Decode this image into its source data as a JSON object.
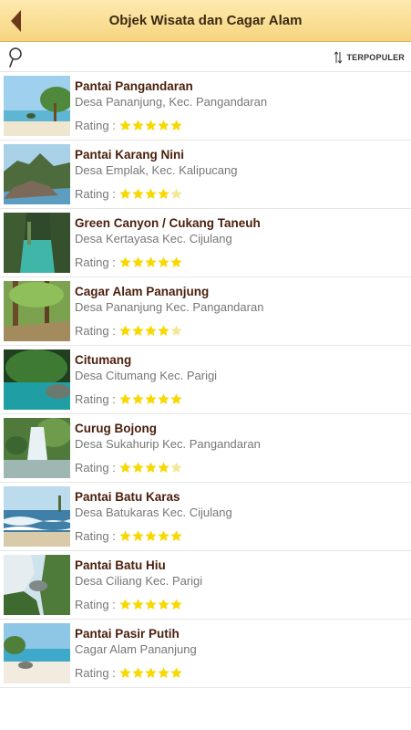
{
  "header": {
    "title": "Objek Wisata dan Cagar Alam"
  },
  "toolbar": {
    "sort_label": "TERPOPULER"
  },
  "rating_label": "Rating :",
  "colors": {
    "header_bg": "#f6d57f",
    "title_text": "#4a1f0c",
    "star_filled": "#f7d800",
    "star_empty": "#f3e89a"
  },
  "places": [
    {
      "name": "Pantai Pangandaran",
      "location": "Desa Pananjung, Kec. Pangandaran",
      "rating": 5,
      "thumb": "beach-palms"
    },
    {
      "name": "Pantai Karang Nini",
      "location": "Desa Emplak, Kec. Kalipucang",
      "rating": 4,
      "thumb": "rocky-coast"
    },
    {
      "name": "Green Canyon / Cukang Taneuh",
      "location": "Desa Kertayasa Kec. Cijulang",
      "rating": 5,
      "thumb": "canyon"
    },
    {
      "name": "Cagar Alam Pananjung",
      "location": "Desa Pananjung Kec. Pangandaran",
      "rating": 4,
      "thumb": "forest"
    },
    {
      "name": "Citumang",
      "location": "Desa Citumang Kec. Parigi",
      "rating": 5,
      "thumb": "river"
    },
    {
      "name": "Curug Bojong",
      "location": "Desa Sukahurip Kec. Pangandaran",
      "rating": 4,
      "thumb": "waterfall"
    },
    {
      "name": "Pantai Batu Karas",
      "location": "Desa Batukaras Kec. Cijulang",
      "rating": 5,
      "thumb": "waves"
    },
    {
      "name": "Pantai Batu Hiu",
      "location": "Desa Ciliang Kec. Parigi",
      "rating": 5,
      "thumb": "cliff"
    },
    {
      "name": "Pantai Pasir Putih",
      "location": "Cagar Alam Pananjung",
      "rating": 5,
      "thumb": "white-sand"
    }
  ]
}
